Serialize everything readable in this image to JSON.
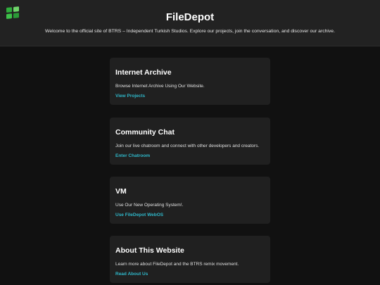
{
  "header": {
    "logo_icon": "windows-logo-icon",
    "title": "FileDepot",
    "tagline": "Welcome to the official site of BTRS – Independent Turkish Studios. Explore our projects, join the conversation, and discover our archive."
  },
  "accent_color": "#2fb7c9",
  "cards": [
    {
      "title": "Internet Archive",
      "description": "Browse Internet Archive Using Our Website.",
      "link": "View Projects"
    },
    {
      "title": "Community Chat",
      "description": "Join our live chatroom and connect with other developers and creators.",
      "link": "Enter Chatroom"
    },
    {
      "title": "VM",
      "description": "Use Our New Operating System!.",
      "link": "Use FileDepot WebOS"
    },
    {
      "title": "About This Website",
      "description": "Learn more about FileDepot and the BTRS remix movement.",
      "link": "Read About Us"
    }
  ]
}
